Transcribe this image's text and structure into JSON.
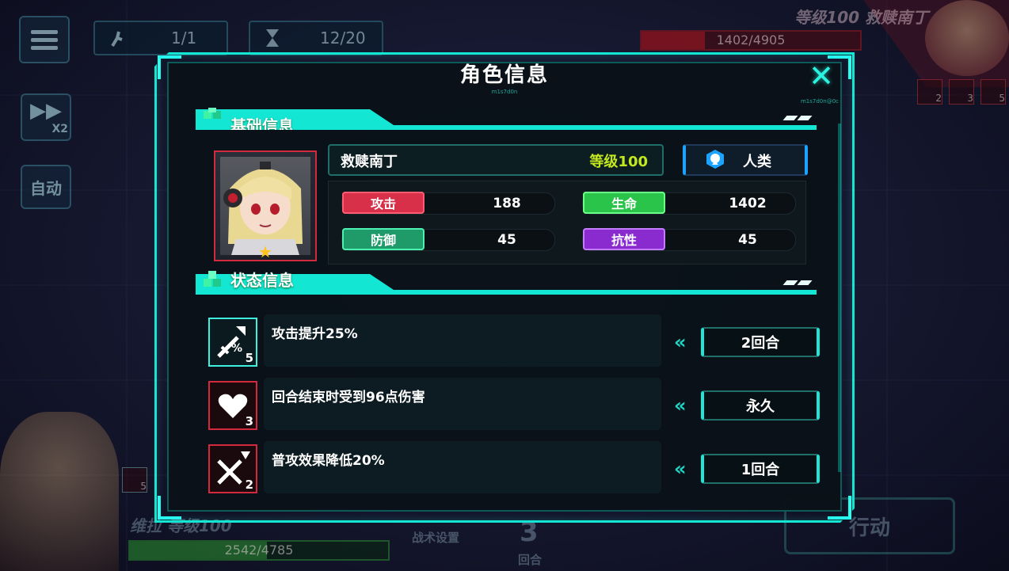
{
  "hud": {
    "unit_count": "1/1",
    "turn_counter": "12/20",
    "speed_label": "X2",
    "auto_label": "自动",
    "enemy_name_level": "等级100  救赎南丁",
    "enemy_hp": "1402/4905",
    "enemy_hp_fraction": 0.29,
    "enemy_buff_counts": [
      "2",
      "3",
      "5"
    ],
    "ally_name_level": "维拉  等级100",
    "ally_hp": "2542/4785",
    "ally_hp_fraction": 0.53,
    "ally_buff_count": "5",
    "tactics_label": "战术设置",
    "round_number": "3",
    "round_label": "回合",
    "action_label": "行动"
  },
  "dialog": {
    "title": "角色信息",
    "title_sub": "m1s7d0n",
    "topdeco": "m1s7d0n@0c",
    "close_symbol": "✕"
  },
  "basic_info": {
    "header": "基础信息",
    "name": "救赎南丁",
    "level": "等级100",
    "race": "人类",
    "star": "★",
    "stats": [
      {
        "label": "攻击",
        "value": "188",
        "color": "#d9304a",
        "border": "#ff5c74"
      },
      {
        "label": "生命",
        "value": "1402",
        "color": "#2bc44a",
        "border": "#6cff88"
      },
      {
        "label": "防御",
        "value": "45",
        "color": "#1f9b6a",
        "border": "#4cf0b0"
      },
      {
        "label": "抗性",
        "value": "45",
        "color": "#8a2bd0",
        "border": "#c37cff"
      }
    ]
  },
  "status_info": {
    "header": "状态信息",
    "items": [
      {
        "desc": "攻击提升25%",
        "duration": "2回合",
        "count": "5",
        "type": "buff",
        "icon": "sword-up-icon"
      },
      {
        "desc": "回合结束时受到96点伤害",
        "duration": "永久",
        "count": "3",
        "type": "debuff",
        "icon": "heart-icon"
      },
      {
        "desc": "普攻效果降低20%",
        "duration": "1回合",
        "count": "2",
        "type": "debuff",
        "icon": "crossed-swords-down-icon"
      }
    ],
    "arrow_glyph": "«"
  }
}
